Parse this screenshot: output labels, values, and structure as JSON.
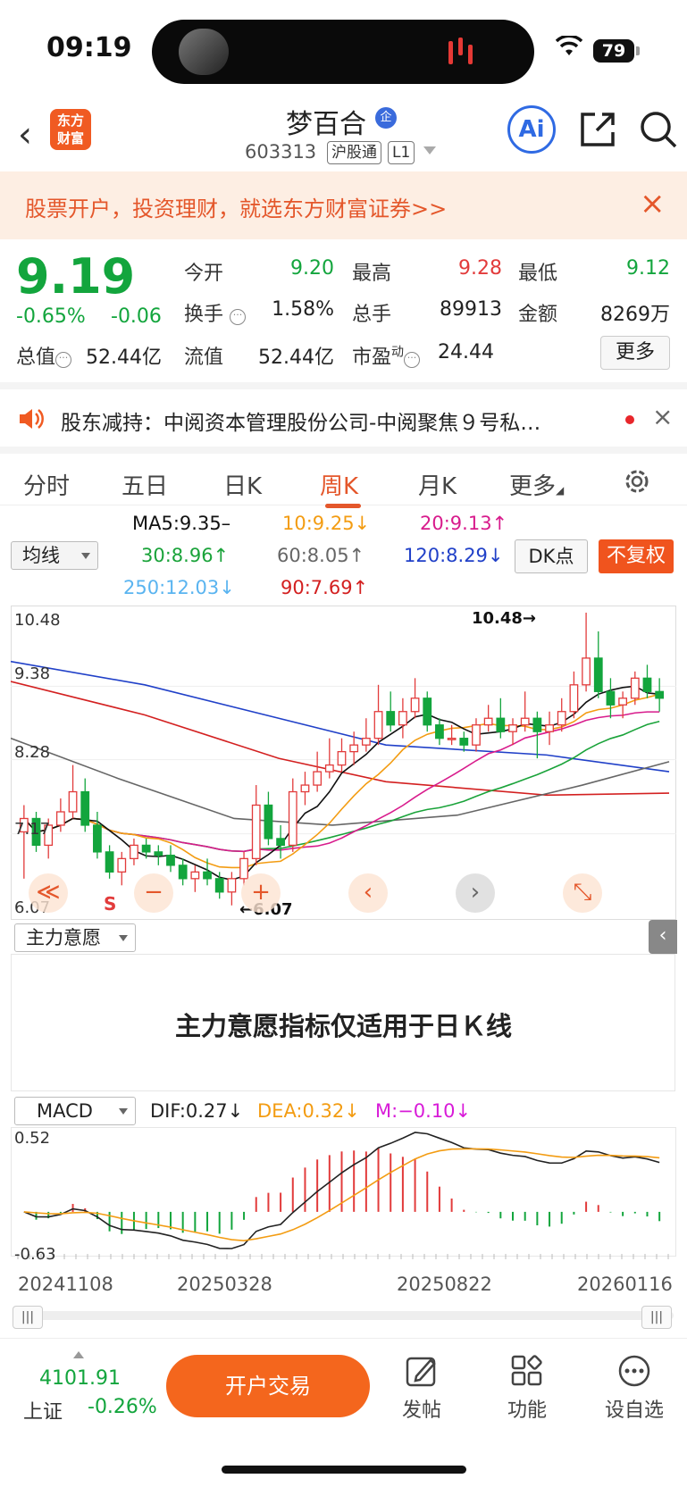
{
  "status": {
    "time": "09:19",
    "battery": "79"
  },
  "header": {
    "logo_line1": "东方",
    "logo_line2": "财富",
    "name": "梦百合",
    "badge": "企",
    "code": "603313",
    "tag1": "沪股通",
    "tag2": "L1",
    "ai_label": "Ai"
  },
  "banner": {
    "text": "股票开户，投资理财，就选东方财富证券>>",
    "close": "×"
  },
  "quote": {
    "price": "9.19",
    "change_pct": "-0.65%",
    "change": "-0.06",
    "open_label": "今开",
    "open": "9.20",
    "high_label": "最高",
    "high": "9.28",
    "low_label": "最低",
    "low": "9.12",
    "turnover_label": "换手",
    "turnover": "1.58%",
    "volume_label": "总手",
    "volume": "89913",
    "amount_label": "金额",
    "amount": "8269万",
    "mcap_label": "总值",
    "mcap": "52.44亿",
    "float_label": "流值",
    "float": "52.44亿",
    "pe_label": "市盈",
    "pe_sup": "动",
    "pe": "24.44",
    "more": "更多"
  },
  "notice": {
    "text": "股东减持：中阅资本管理股份公司-中阅聚焦９号私…",
    "close": "×"
  },
  "tabs": [
    "分时",
    "五日",
    "日K",
    "周K",
    "月K",
    "更多"
  ],
  "active_tab": "周K",
  "ma": {
    "selector": "均线",
    "ma5": "MA5:9.35–",
    "ma10": "10:9.25↓",
    "ma20": "20:9.13↑",
    "ma30": "30:8.96↑",
    "ma60": "60:8.05↑",
    "ma120": "120:8.29↓",
    "ma250": "250:12.03↓",
    "ma90": "90:7.69↑",
    "dk": "DK点",
    "fq": "不复权",
    "colors": {
      "ma5": "#111111",
      "ma10": "#f39c12",
      "ma20": "#d81b8c",
      "ma30": "#1aa33a",
      "ma60": "#666666",
      "ma120": "#2040c8",
      "ma250": "#5ab4f0",
      "ma90": "#d32020"
    }
  },
  "kchart": {
    "y_labels": [
      "10.48",
      "9.38",
      "8.28",
      "7.17",
      "6.07"
    ],
    "max_label": "10.48→",
    "min_label": "←6.07",
    "s_mark": "S",
    "nav": {
      "first": "≪",
      "zoom_out": "−",
      "zoom_in": "+",
      "prev": "‹",
      "next": "›",
      "full": "⤡"
    }
  },
  "zhuli": {
    "selector": "主力意愿",
    "message": "主力意愿指标仅适用于日Ｋ线",
    "side_tab": "‹"
  },
  "macd": {
    "selector": "MACD",
    "dif": "DIF:0.27↓",
    "dea": "DEA:0.32↓",
    "m": "M:−0.10↓",
    "y_top": "0.52",
    "y_bottom": "-0.63"
  },
  "dates": [
    "20241108",
    "20250328",
    "20250822",
    "20260116"
  ],
  "scroll": {
    "left": "|||",
    "right": "|||"
  },
  "bottom": {
    "index_value": "4101.91",
    "index_name": "上证",
    "index_pct": "-0.26%",
    "trade": "开户交易",
    "post": "发帖",
    "func": "功能",
    "watch": "设自选"
  },
  "chart_data": {
    "type": "candlestick",
    "period": "weekly",
    "ylim": [
      6.07,
      10.48
    ],
    "high_marker": 10.48,
    "low_marker": 6.07,
    "candles": [
      [
        7.2,
        7.6,
        6.5,
        7.4
      ],
      [
        7.4,
        7.5,
        6.9,
        7.0
      ],
      [
        7.0,
        7.4,
        6.8,
        7.3
      ],
      [
        7.3,
        7.7,
        7.2,
        7.5
      ],
      [
        7.5,
        8.2,
        7.4,
        7.8
      ],
      [
        7.8,
        8.0,
        7.2,
        7.3
      ],
      [
        7.3,
        7.5,
        6.8,
        6.9
      ],
      [
        6.9,
        7.0,
        6.5,
        6.6
      ],
      [
        6.6,
        6.9,
        6.4,
        6.8
      ],
      [
        6.8,
        7.1,
        6.7,
        7.0
      ],
      [
        7.0,
        7.1,
        6.8,
        6.9
      ],
      [
        6.9,
        7.0,
        6.7,
        6.85
      ],
      [
        6.85,
        7.0,
        6.6,
        6.7
      ],
      [
        6.7,
        6.8,
        6.4,
        6.5
      ],
      [
        6.5,
        6.7,
        6.3,
        6.6
      ],
      [
        6.6,
        6.8,
        6.4,
        6.5
      ],
      [
        6.5,
        6.6,
        6.2,
        6.3
      ],
      [
        6.3,
        6.6,
        6.1,
        6.5
      ],
      [
        6.5,
        6.9,
        6.4,
        6.8
      ],
      [
        6.8,
        7.9,
        6.7,
        7.6
      ],
      [
        7.6,
        7.8,
        7.0,
        7.1
      ],
      [
        7.1,
        7.3,
        6.8,
        7.0
      ],
      [
        7.0,
        8.0,
        6.9,
        7.8
      ],
      [
        7.8,
        8.1,
        7.6,
        7.9
      ],
      [
        7.9,
        8.4,
        7.8,
        8.1
      ],
      [
        8.1,
        8.6,
        8.0,
        8.2
      ],
      [
        8.2,
        8.6,
        8.1,
        8.4
      ],
      [
        8.4,
        8.7,
        8.2,
        8.5
      ],
      [
        8.5,
        8.9,
        8.4,
        8.6
      ],
      [
        8.6,
        9.4,
        8.5,
        9.0
      ],
      [
        9.0,
        9.3,
        8.7,
        8.8
      ],
      [
        8.8,
        9.2,
        8.6,
        9.0
      ],
      [
        9.0,
        9.5,
        8.9,
        9.2
      ],
      [
        9.2,
        9.3,
        8.7,
        8.8
      ],
      [
        8.8,
        8.9,
        8.5,
        8.6
      ],
      [
        8.6,
        8.8,
        8.5,
        8.6
      ],
      [
        8.6,
        8.7,
        8.4,
        8.5
      ],
      [
        8.5,
        8.9,
        8.4,
        8.8
      ],
      [
        8.8,
        9.1,
        8.7,
        8.9
      ],
      [
        8.9,
        9.2,
        8.6,
        8.7
      ],
      [
        8.7,
        8.9,
        8.5,
        8.8
      ],
      [
        8.8,
        9.3,
        8.7,
        8.9
      ],
      [
        8.9,
        9.0,
        8.3,
        8.7
      ],
      [
        8.7,
        9.0,
        8.5,
        8.8
      ],
      [
        8.8,
        9.2,
        8.7,
        9.0
      ],
      [
        9.0,
        9.6,
        8.9,
        9.4
      ],
      [
        9.4,
        10.48,
        9.3,
        9.8
      ],
      [
        9.8,
        10.2,
        9.2,
        9.3
      ],
      [
        9.3,
        9.5,
        8.9,
        9.1
      ],
      [
        9.1,
        9.3,
        8.9,
        9.2
      ],
      [
        9.2,
        9.6,
        9.1,
        9.5
      ],
      [
        9.5,
        9.7,
        9.2,
        9.3
      ],
      [
        9.3,
        9.5,
        9.0,
        9.2
      ]
    ]
  }
}
